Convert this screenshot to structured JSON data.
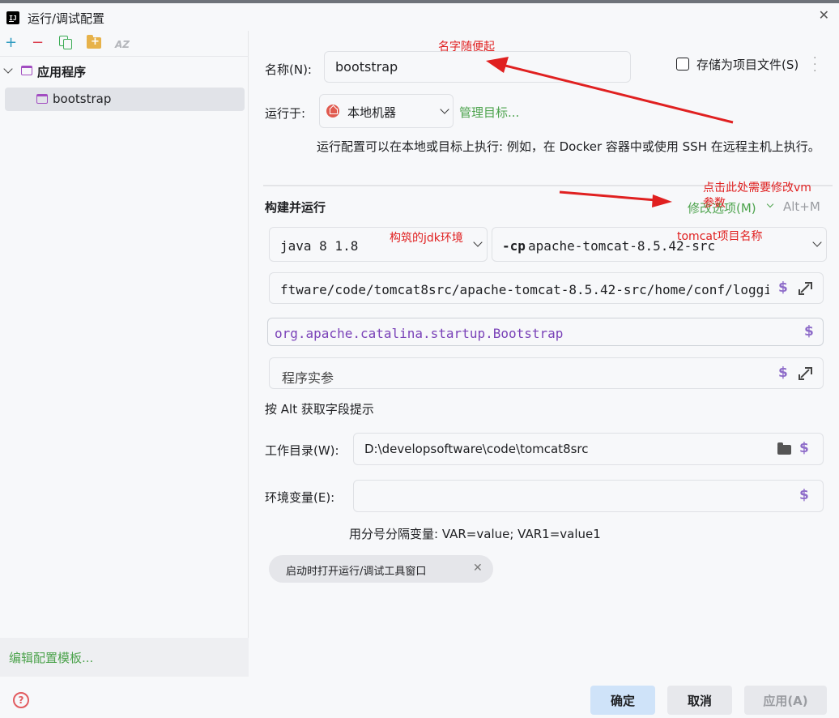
{
  "window": {
    "title": "运行/调试配置"
  },
  "sidebar": {
    "group_label": "应用程序",
    "item_label": "bootstrap",
    "edit_templates": "编辑配置模板..."
  },
  "form": {
    "name_label": "名称(N):",
    "name_value": "bootstrap",
    "store_as_project_file": "存储为项目文件(S)",
    "store_checked": false,
    "run_on_label": "运行于:",
    "run_on_value": "本地机器",
    "manage_targets": "管理目标...",
    "run_on_hint": "运行配置可以在本地或目标上执行: 例如，在 Docker 容器中或使用 SSH 在远程主机上执行。",
    "build_run_title": "构建并运行",
    "modify_options": "修改选项(M)",
    "modify_shortcut": "Alt+M",
    "jdk_value": "java 8  1.8",
    "classpath_flag": "-cp",
    "classpath_value": "apache-tomcat-8.5.42-src",
    "vm_options_value": "ftware/code/tomcat8src/apache-tomcat-8.5.42-src/home/conf/logging.properties",
    "main_class_value": "org.apache.catalina.startup.Bootstrap",
    "program_args_placeholder": "程序实参",
    "alt_hint": "按 Alt 获取字段提示",
    "workdir_label": "工作目录(W):",
    "workdir_value": "D:\\developsoftware\\code\\tomcat8src",
    "env_label": "环境变量(E):",
    "env_value": "",
    "env_hint": "用分号分隔变量: VAR=value; VAR1=value1",
    "chip_label": "启动时打开运行/调试工具窗口"
  },
  "footer": {
    "ok": "确定",
    "cancel": "取消",
    "apply": "应用(A)"
  },
  "annotations": {
    "name_note": "名字随便起",
    "vm_note_line1": "点击此处需要修改vm",
    "vm_note_line2": "参数",
    "jdk_note": "构筑的jdk环境",
    "tomcat_note": "tomcat项目名称"
  },
  "colors": {
    "accent_green": "#4da34d",
    "annotation_red": "#e02020",
    "variable_purple": "#8e6cc9",
    "ok_button_bg": "#cfe3f9"
  },
  "icons": [
    "app-icon",
    "close-icon",
    "add-icon",
    "remove-icon",
    "copy-icon",
    "folder-add-icon",
    "sort-icon",
    "chevron-down-icon",
    "window-icon",
    "home-icon",
    "dollar-icon",
    "expand-icon",
    "folder-icon",
    "help-icon"
  ]
}
